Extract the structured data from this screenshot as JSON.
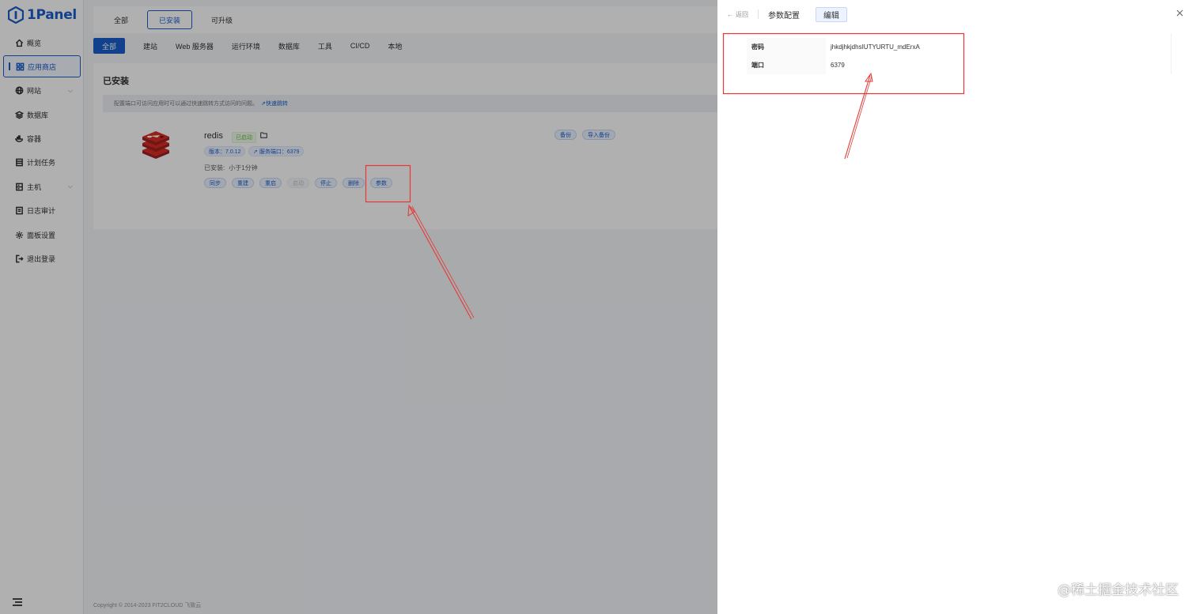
{
  "app": {
    "logo_text": "1Panel"
  },
  "sidebar": {
    "items": [
      {
        "label": "概览",
        "icon": "home-icon"
      },
      {
        "label": "应用商店",
        "icon": "apps-grid-icon",
        "active": true
      },
      {
        "label": "网站",
        "icon": "globe-icon",
        "expandable": true
      },
      {
        "label": "数据库",
        "icon": "database-icon"
      },
      {
        "label": "容器",
        "icon": "container-icon"
      },
      {
        "label": "计划任务",
        "icon": "schedule-icon"
      },
      {
        "label": "主机",
        "icon": "host-icon",
        "expandable": true
      },
      {
        "label": "日志审计",
        "icon": "log-icon"
      },
      {
        "label": "面板设置",
        "icon": "gear-icon"
      },
      {
        "label": "退出登录",
        "icon": "logout-icon"
      }
    ]
  },
  "top_tabs": [
    {
      "label": "全部"
    },
    {
      "label": "已安装",
      "active": true
    },
    {
      "label": "可升级"
    }
  ],
  "categories": [
    {
      "label": "全部",
      "active": true
    },
    {
      "label": "建站"
    },
    {
      "label": "Web 服务器"
    },
    {
      "label": "运行环境"
    },
    {
      "label": "数据库"
    },
    {
      "label": "工具"
    },
    {
      "label": "CI/CD"
    },
    {
      "label": "本地"
    }
  ],
  "installed_panel": {
    "title": "已安装",
    "notice": "配置端口可访问应用时可以通过快速跳转方式访问的问题。",
    "notice_link": "快速跳转",
    "app": {
      "name": "redis",
      "status": "已启动",
      "version_tag": "版本：7.0.12",
      "port_tag": "服务端口：6379",
      "installed_label": "已安装:",
      "installed_time": "小于1分钟",
      "actions": [
        "同步",
        "重建",
        "重启",
        "启动",
        "停止",
        "删除",
        "参数"
      ],
      "disabled_action": "启动",
      "right_actions": [
        "备份",
        "导入备份"
      ]
    }
  },
  "footer": {
    "copyright": "Copyright © 2014-2023 FIT2CLOUD 飞致云"
  },
  "drawer": {
    "back_label": "返回",
    "title": "参数配置",
    "edit_button": "编辑",
    "rows": [
      {
        "label": "密码",
        "value": "jhkdjhkjdhsIUTYURTU_mdErxA"
      },
      {
        "label": "端口",
        "value": "6379"
      }
    ]
  },
  "watermark": "@稀土掘金技术社区",
  "colors": {
    "brand": "#1a5fcc",
    "annotation": "#e53935",
    "success": "#67c23a"
  }
}
